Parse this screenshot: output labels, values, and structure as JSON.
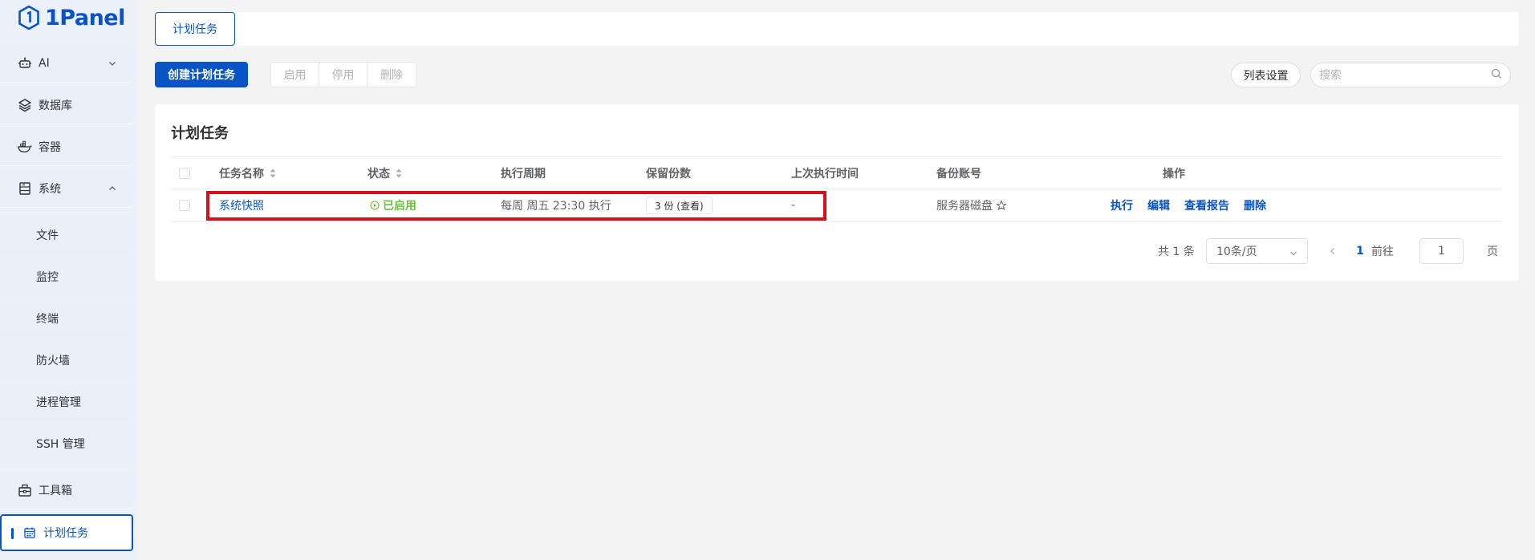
{
  "app": {
    "logo_text": "1Panel",
    "accent_color": "#0854c7",
    "highlight_color": "#d0121b"
  },
  "sidebar": {
    "items": [
      {
        "label": "AI",
        "icon": "robot-icon",
        "expandable": true,
        "expanded": false
      },
      {
        "label": "数据库",
        "icon": "layers-icon"
      },
      {
        "label": "容器",
        "icon": "docker-whale-icon"
      },
      {
        "label": "系统",
        "icon": "server-icon",
        "expandable": true,
        "expanded": true
      },
      {
        "label": "工具箱",
        "icon": "toolbox-icon"
      },
      {
        "label": "计划任务",
        "icon": "calendar-icon",
        "active": true
      }
    ],
    "sub_items": [
      "文件",
      "监控",
      "终端",
      "防火墙",
      "进程管理",
      "SSH 管理"
    ]
  },
  "tabs": [
    {
      "label": "计划任务",
      "active": true
    }
  ],
  "toolbar": {
    "create_label": "创建计划任务",
    "enable_label": "启用",
    "disable_label": "停用",
    "delete_label": "删除",
    "list_settings_label": "列表设置",
    "search_placeholder": "搜索"
  },
  "card": {
    "title": "计划任务"
  },
  "table": {
    "columns": [
      "任务名称",
      "状态",
      "执行周期",
      "保留份数",
      "上次执行时间",
      "备份账号",
      "操作"
    ],
    "rows": [
      {
        "name": "系统快照",
        "status": "已启用",
        "period": "每周 周五 23:30 执行",
        "retain": "3 份 (查看)",
        "last_run": "-",
        "backup_account": "服务器磁盘",
        "backup_default": true,
        "actions": [
          "执行",
          "编辑",
          "查看报告",
          "删除"
        ]
      }
    ]
  },
  "pagination": {
    "total_text": "共 1 条",
    "page_size": "10条/页",
    "current_page": "1",
    "goto_label": "前往",
    "goto_value": "1",
    "page_suffix": "页"
  }
}
